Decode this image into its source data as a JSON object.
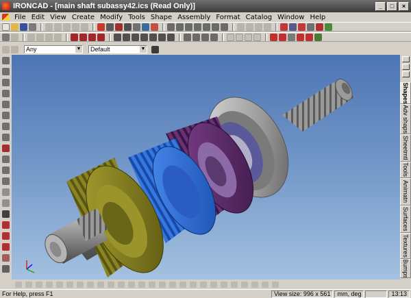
{
  "window": {
    "title": "IRONCAD - [main shaft subassy42.ics (Read Only)]",
    "controls": [
      "_",
      "□",
      "×"
    ]
  },
  "menubar": {
    "items": [
      "File",
      "Edit",
      "View",
      "Create",
      "Modify",
      "Tools",
      "Shape",
      "Assembly",
      "Format",
      "Catalog",
      "Window",
      "Help"
    ]
  },
  "selection_bar": {
    "filter_value": "Any",
    "style_value": "Default"
  },
  "right_tabs": [
    "Shapes",
    "Adv shaps",
    "Sheetmtl",
    "Tools",
    "Animatn",
    "Surfaces",
    "Textures",
    "Bumps",
    "C"
  ],
  "statusbar": {
    "help_text": "For Help, press F1",
    "view_size": "View size: 996 x 561",
    "units": "mm, deg",
    "time": "13:13"
  },
  "colors": {
    "viewport_top": "#4d75b4",
    "viewport_bottom": "#a4c1e0",
    "gear_yellow": "#7f7a1f",
    "gear_blue": "#2d6fd8",
    "gear_purple": "#5b2a66",
    "steel": "#8e8e8e"
  },
  "icons": {
    "app": "ironcad-logo-icon",
    "axis_triad": "xyz-axis-triad-icon"
  }
}
